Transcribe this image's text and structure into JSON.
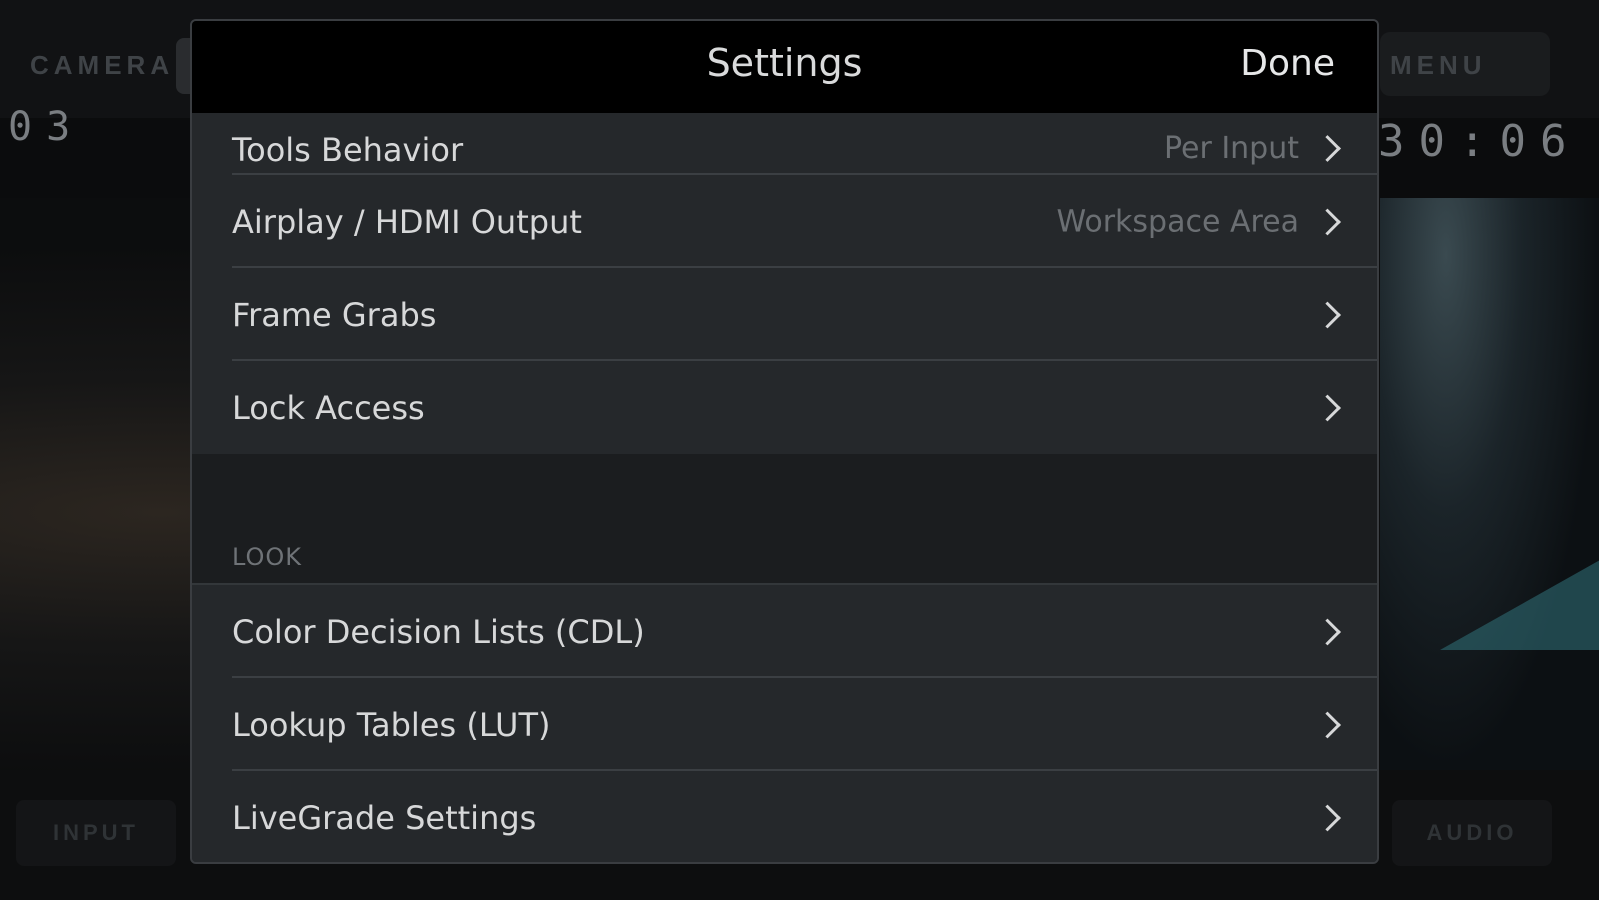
{
  "background": {
    "top_left_label": "CAMERA",
    "top_right_label": "MENU",
    "left_readout": "03",
    "right_readout": "30:06",
    "bottom_left_button": "INPUT",
    "bottom_right_button": "AUDIO"
  },
  "settings": {
    "title": "Settings",
    "done_label": "Done",
    "general_items": [
      {
        "label": "Tools Behavior",
        "value": "Per Input"
      },
      {
        "label": "Airplay / HDMI Output",
        "value": "Workspace Area"
      },
      {
        "label": "Frame Grabs",
        "value": ""
      },
      {
        "label": "Lock Access",
        "value": ""
      }
    ],
    "look_section_header": "LOOK",
    "look_items": [
      {
        "label": "Color Decision Lists  (CDL)"
      },
      {
        "label": "Lookup Tables  (LUT)"
      },
      {
        "label": "LiveGrade Settings"
      }
    ]
  }
}
